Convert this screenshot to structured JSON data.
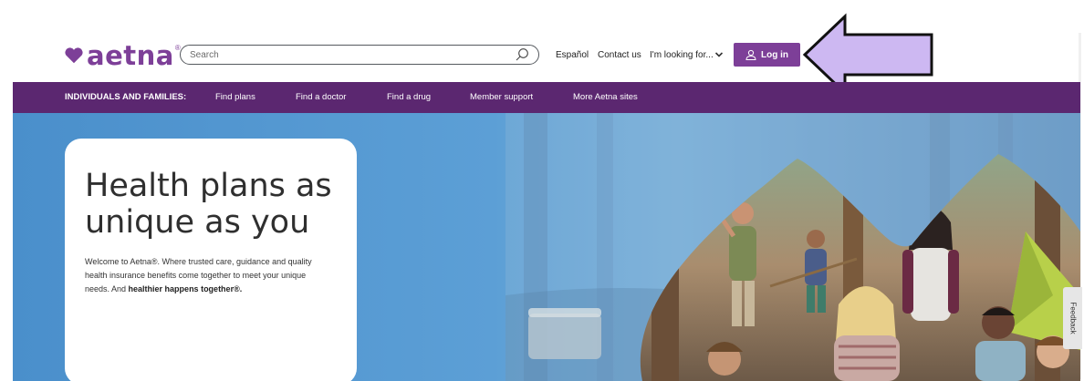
{
  "header": {
    "logo_text": "aetna",
    "logo_reg": "®",
    "search_placeholder": "Search",
    "links": {
      "espanol": "Español",
      "contact_us": "Contact us",
      "looking_for": "I'm looking for..."
    },
    "login_label": "Log in"
  },
  "nav": {
    "heading": "INDIVIDUALS AND FAMILIES:",
    "items": [
      "Find plans",
      "Find a doctor",
      "Find a drug",
      "Member support",
      "More Aetna sites"
    ]
  },
  "hero": {
    "title": "Health plans as unique as you",
    "intro": "Welcome to Aetna®. Where trusted care, guidance and quality health insurance benefits come together to meet your unique needs. And ",
    "emphasis": "healthier happens together®."
  },
  "feedback_label": "Feedback",
  "colors": {
    "brand_purple": "#7d3f98",
    "nav_purple": "#5b2770",
    "hero_blue": "#5c9fd6",
    "annotation_arrow_fill": "#cdb8f2"
  },
  "icons": {
    "search": "search-icon",
    "chevron": "chevron-down-icon",
    "user": "user-icon",
    "arrow": "arrow-left-annotation-icon",
    "heart": "heart-logo-icon"
  }
}
